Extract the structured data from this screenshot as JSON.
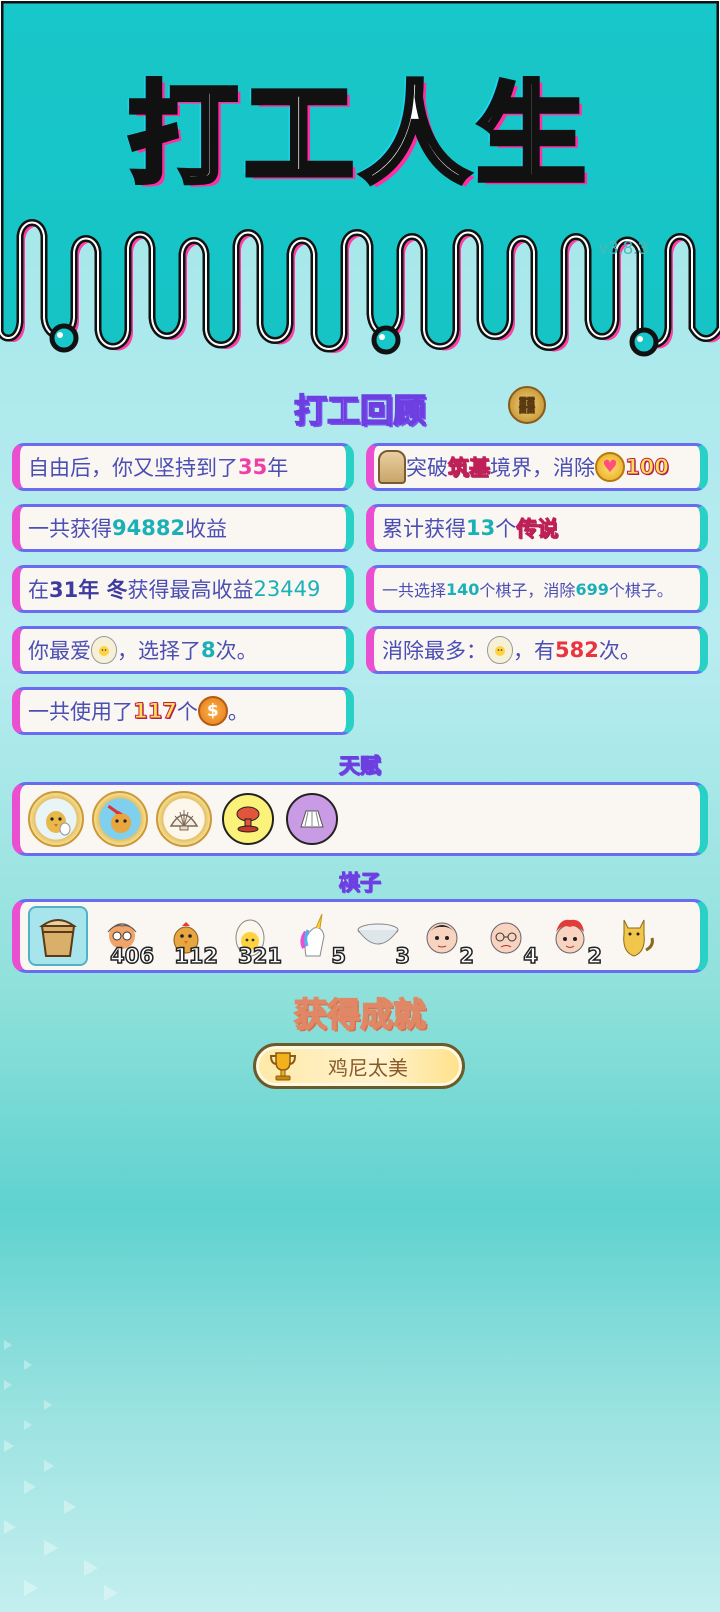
{
  "app": {
    "title": "打工人生",
    "version": "v3.8.3"
  },
  "recap": {
    "title": "打工回顾",
    "badge_icon": "coin-badge-icon",
    "left": [
      {
        "parts": [
          "自由后，你又坚持到了",
          "35",
          "年"
        ]
      },
      {
        "parts": [
          "一共获得",
          "94882",
          "收益"
        ]
      },
      {
        "parts": [
          "在 ",
          "31年 冬",
          " 获得最高收益",
          "23449"
        ]
      },
      {
        "parts": [
          "你最爱",
          "，选择了",
          "8",
          "次。"
        ]
      },
      {
        "parts": [
          "一共使用了",
          "117",
          "个",
          "。"
        ]
      }
    ],
    "right": [
      {
        "parts": [
          "突破",
          "筑基",
          "境界，消除",
          "100"
        ]
      },
      {
        "parts": [
          "累计获得",
          "13",
          "个",
          "传说"
        ]
      },
      {
        "parts": [
          "一共选择",
          "140",
          "个棋子，消除",
          "699",
          "个棋子。"
        ]
      },
      {
        "parts": [
          "消除最多：",
          "，有",
          "582",
          "次。"
        ]
      }
    ]
  },
  "talents": {
    "title": "天赋",
    "items": [
      {
        "icon": "chick-talent-icon"
      },
      {
        "icon": "chick-injection-talent-icon"
      },
      {
        "icon": "shell-talent-icon"
      },
      {
        "icon": "mushroom-cloud-talent-icon"
      },
      {
        "icon": "skirt-talent-icon"
      }
    ]
  },
  "pieces": {
    "title": "棋子",
    "items": [
      {
        "icon": "bucket-piece-icon",
        "count": ""
      },
      {
        "icon": "grandpa-piece-icon",
        "count": "406"
      },
      {
        "icon": "chick-piece-icon",
        "count": "112"
      },
      {
        "icon": "egg-piece-icon",
        "count": "321"
      },
      {
        "icon": "unicorn-piece-icon",
        "count": "5"
      },
      {
        "icon": "bowl-piece-icon",
        "count": "3"
      },
      {
        "icon": "man-face-piece-icon",
        "count": "2"
      },
      {
        "icon": "old-man-face-piece-icon",
        "count": "4"
      },
      {
        "icon": "red-hair-face-piece-icon",
        "count": "2"
      },
      {
        "icon": "cat-piece-icon",
        "count": ""
      }
    ]
  },
  "achievements": {
    "title": "获得成就",
    "items": [
      {
        "icon": "trophy-icon",
        "label": "鸡尼太美"
      }
    ]
  },
  "colors": {
    "teal": "#1cc8c8",
    "pink": "#ee3fa8",
    "purple": "#6a6cf0"
  }
}
